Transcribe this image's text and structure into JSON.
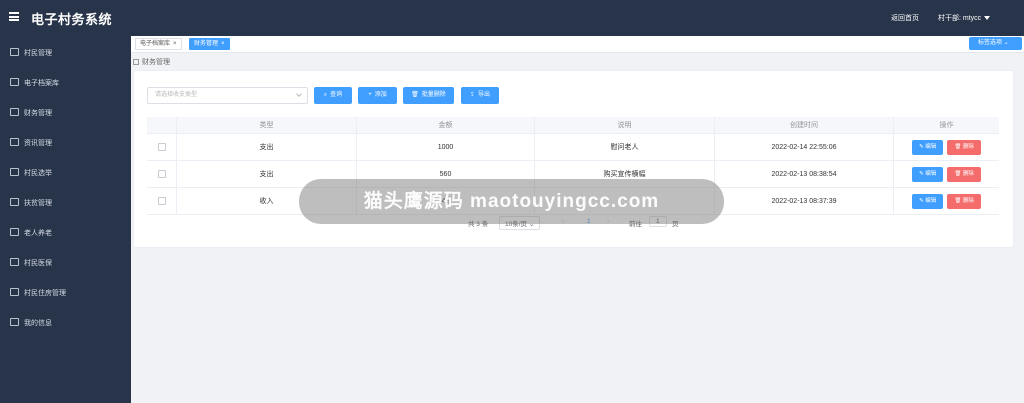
{
  "app": {
    "title": "电子村务系统"
  },
  "header": {
    "home_link": "返回首页",
    "user_label": "村干部: mtycc"
  },
  "sidebar": {
    "items": [
      {
        "label": "村民管理",
        "icon": "user-icon"
      },
      {
        "label": "电子档案库",
        "icon": "folder-icon"
      },
      {
        "label": "财务管理",
        "icon": "wallet-icon"
      },
      {
        "label": "资讯管理",
        "icon": "news-icon"
      },
      {
        "label": "村民选举",
        "icon": "vote-hand-icon"
      },
      {
        "label": "扶贫管理",
        "icon": "document-icon"
      },
      {
        "label": "老人养老",
        "icon": "card-icon"
      },
      {
        "label": "村民医保",
        "icon": "medical-icon"
      },
      {
        "label": "村民住房管理",
        "icon": "house-icon"
      },
      {
        "label": "我的信息",
        "icon": "profile-icon"
      }
    ]
  },
  "tabs": [
    {
      "label": "电子档案库",
      "close": "×",
      "active": false
    },
    {
      "label": "财务管理",
      "close": "×",
      "active": true
    }
  ],
  "tab_options": "标签选项 ⌄",
  "breadcrumb": {
    "label": "财务管理"
  },
  "filter": {
    "placeholder": "请选择收支类型"
  },
  "toolbar": {
    "query": {
      "icon": "⌕",
      "label": "查询"
    },
    "add": {
      "icon": "+",
      "label": "添加"
    },
    "batch_delete": {
      "icon": "🗑",
      "label": "批量删除"
    },
    "export": {
      "icon": "⇪",
      "label": "导出"
    }
  },
  "table": {
    "columns": [
      "类型",
      "金额",
      "说明",
      "创建时间",
      "操作"
    ],
    "rows": [
      {
        "type": "支出",
        "amount": "1000",
        "note": "慰问老人",
        "created": "2022-02-14 22:55:06"
      },
      {
        "type": "支出",
        "amount": "560",
        "note": "购买宣传横幅",
        "created": "2022-02-13 08:38:54"
      },
      {
        "type": "收入",
        "amount": "42",
        "note": "",
        "created": "2022-02-13 08:37:39"
      }
    ],
    "edit_label": "编辑",
    "delete_label": "删除"
  },
  "pagination": {
    "total": "共 3 条",
    "page_size": "10条/页 ⌄",
    "prev": "‹",
    "current_page": "1",
    "next": "›",
    "goto_label": "前往",
    "goto_value": "1",
    "page_unit": "页"
  },
  "watermark": {
    "text": "猫头鹰源码 maotouyingcc.com"
  },
  "colors": {
    "nav_bg": "#27344a",
    "primary": "#409eff",
    "danger": "#f56c6c"
  }
}
